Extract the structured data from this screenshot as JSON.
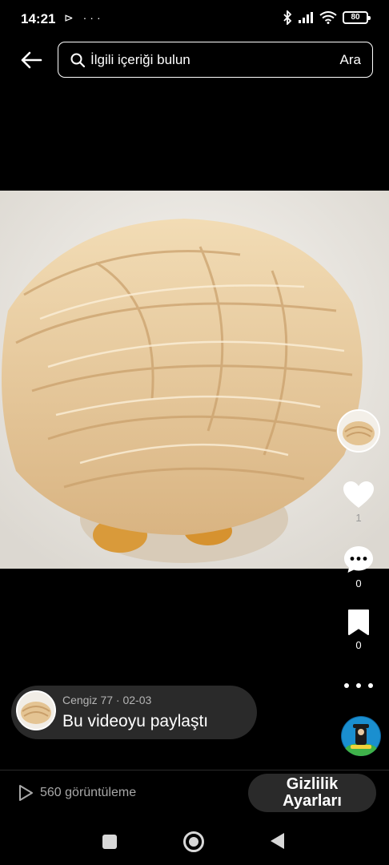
{
  "status_bar": {
    "time": "14:21",
    "left_icons": "⊳ ···",
    "battery": "80",
    "icons": [
      "bluetooth-icon",
      "signal-icon",
      "wifi-icon",
      "battery-icon"
    ]
  },
  "search": {
    "placeholder": "İlgili içeriği bulun",
    "submit_label": "Ara"
  },
  "video": {
    "subject": "shredded-chicken-over-rice-image"
  },
  "actions": {
    "like_count": "1",
    "comment_count": "0",
    "favorite_count": "0"
  },
  "shared_by": {
    "meta": "Cengiz 77 · 02-03",
    "text": "Bu videoyu paylaştı"
  },
  "footer": {
    "views": "560 görüntüleme",
    "privacy_button": "Gizlilik Ayarları"
  },
  "colors": {
    "background": "#000000",
    "pill": "#2a2a2a",
    "muted_text": "#a8a8a8"
  }
}
